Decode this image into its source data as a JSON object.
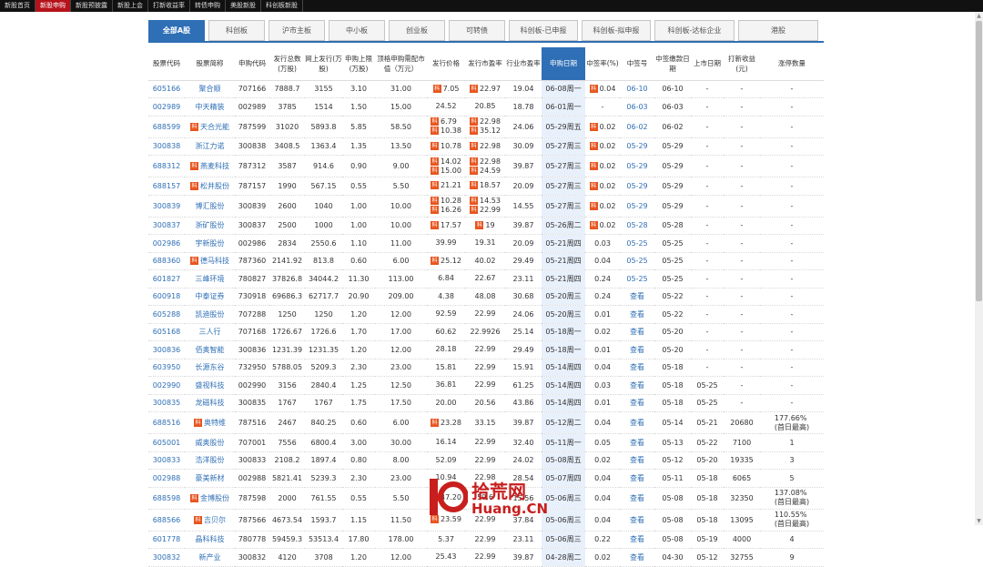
{
  "topnav": [
    {
      "label": "新股首页",
      "active": false
    },
    {
      "label": "新股申购",
      "active": true
    },
    {
      "label": "新股预披露",
      "active": false
    },
    {
      "label": "新股上会",
      "active": false
    },
    {
      "label": "打新收益率",
      "active": false
    },
    {
      "label": "转债申购",
      "active": false
    },
    {
      "label": "美股新股",
      "active": false
    },
    {
      "label": "科创板新股",
      "active": false
    }
  ],
  "tabs": [
    {
      "label": "全部A股",
      "active": true
    },
    {
      "label": "科创板",
      "active": false
    },
    {
      "label": "沪市主板",
      "active": false
    },
    {
      "label": "中小板",
      "active": false
    },
    {
      "label": "创业板",
      "active": false
    },
    {
      "label": "可转债",
      "active": false
    },
    {
      "label": "科创板-已申报",
      "active": false
    },
    {
      "label": "科创板-拟申报",
      "active": false
    },
    {
      "label": "科创板-达标企业",
      "active": false
    },
    {
      "label": "港股",
      "active": false
    }
  ],
  "columns": [
    {
      "label": "股票代码"
    },
    {
      "label": "股票简称"
    },
    {
      "label": "申购代码"
    },
    {
      "label": "发行总数(万股)"
    },
    {
      "label": "网上发行(万股)"
    },
    {
      "label": "申购上限(万股)"
    },
    {
      "label": "顶格申购需配市值（万元）"
    },
    {
      "label": "发行价格"
    },
    {
      "label": "发行市盈率"
    },
    {
      "label": "行业市盈率"
    },
    {
      "label": "申购日期",
      "sorted": true
    },
    {
      "label": "中签率(%)"
    },
    {
      "label": "中签号"
    },
    {
      "label": "中签缴款日期"
    },
    {
      "label": "上市日期"
    },
    {
      "label": "打新收益(元)"
    },
    {
      "label": "涨停数量"
    }
  ],
  "badge_text": "科",
  "rows": [
    {
      "code": "605166",
      "name": "聚合顺",
      "kc": false,
      "subcode": "707166",
      "total": "7888.7",
      "online": "3155",
      "limit": "3.10",
      "cap": "31.00",
      "price": [
        "7.05"
      ],
      "pe": [
        "22.97"
      ],
      "ind_pe": "19.04",
      "date": "06-08周一",
      "rate": "0.04",
      "rate_kc": true,
      "lot": "06-10",
      "pay": "06-10",
      "list": "-",
      "profit": "-",
      "limitup": "-"
    },
    {
      "code": "002989",
      "name": "中天精装",
      "kc": false,
      "subcode": "002989",
      "total": "3785",
      "online": "1514",
      "limit": "1.50",
      "cap": "15.00",
      "price": [
        "24.52"
      ],
      "pe": [
        "20.85"
      ],
      "ind_pe": "18.78",
      "date": "06-01周一",
      "rate": "-",
      "rate_kc": false,
      "lot": "06-03",
      "pay": "06-03",
      "list": "-",
      "profit": "-",
      "limitup": "-"
    },
    {
      "code": "688599",
      "name": "天合光能",
      "kc": true,
      "subcode": "787599",
      "total": "31020",
      "online": "5893.8",
      "limit": "5.85",
      "cap": "58.50",
      "price": [
        "6.79",
        "10.38"
      ],
      "pe": [
        "22.98",
        "35.12"
      ],
      "ind_pe": "24.06",
      "date": "05-29周五",
      "rate": "0.02",
      "rate_kc": true,
      "lot": "06-02",
      "pay": "06-02",
      "list": "-",
      "profit": "-",
      "limitup": "-"
    },
    {
      "code": "300838",
      "name": "浙江力诺",
      "kc": false,
      "subcode": "300838",
      "total": "3408.5",
      "online": "1363.4",
      "limit": "1.35",
      "cap": "13.50",
      "price": [
        "10.78"
      ],
      "pe": [
        "22.98"
      ],
      "ind_pe": "30.09",
      "date": "05-27周三",
      "rate": "0.02",
      "rate_kc": true,
      "lot": "05-29",
      "pay": "05-29",
      "list": "-",
      "profit": "-",
      "limitup": "-"
    },
    {
      "code": "688312",
      "name": "燕麦科技",
      "kc": true,
      "subcode": "787312",
      "total": "3587",
      "online": "914.6",
      "limit": "0.90",
      "cap": "9.00",
      "price": [
        "14.02",
        "15.00"
      ],
      "pe": [
        "22.98",
        "24.59"
      ],
      "ind_pe": "39.87",
      "date": "05-27周三",
      "rate": "0.02",
      "rate_kc": true,
      "lot": "05-29",
      "pay": "05-29",
      "list": "-",
      "profit": "-",
      "limitup": "-"
    },
    {
      "code": "688157",
      "name": "松井股份",
      "kc": true,
      "subcode": "787157",
      "total": "1990",
      "online": "567.15",
      "limit": "0.55",
      "cap": "5.50",
      "price": [
        "21.21"
      ],
      "pe": [
        "18.57"
      ],
      "ind_pe": "20.09",
      "date": "05-27周三",
      "rate": "0.02",
      "rate_kc": true,
      "lot": "05-29",
      "pay": "05-29",
      "list": "-",
      "profit": "-",
      "limitup": "-"
    },
    {
      "code": "300839",
      "name": "博汇股份",
      "kc": false,
      "subcode": "300839",
      "total": "2600",
      "online": "1040",
      "limit": "1.00",
      "cap": "10.00",
      "price": [
        "10.28",
        "16.26"
      ],
      "pe": [
        "14.53",
        "22.99"
      ],
      "ind_pe": "14.55",
      "date": "05-27周三",
      "rate": "0.02",
      "rate_kc": true,
      "lot": "05-29",
      "pay": "05-29",
      "list": "-",
      "profit": "-",
      "limitup": "-"
    },
    {
      "code": "300837",
      "name": "浙矿股份",
      "kc": false,
      "subcode": "300837",
      "total": "2500",
      "online": "1000",
      "limit": "1.00",
      "cap": "10.00",
      "price": [
        "17.57"
      ],
      "pe": [
        "19"
      ],
      "ind_pe": "39.87",
      "date": "05-26周二",
      "rate": "0.02",
      "rate_kc": true,
      "lot": "05-28",
      "pay": "05-28",
      "list": "-",
      "profit": "-",
      "limitup": "-"
    },
    {
      "code": "002986",
      "name": "宇新股份",
      "kc": false,
      "subcode": "002986",
      "total": "2834",
      "online": "2550.6",
      "limit": "1.10",
      "cap": "11.00",
      "price": [
        "39.99"
      ],
      "pe": [
        "19.31"
      ],
      "ind_pe": "20.09",
      "date": "05-21周四",
      "rate": "0.03",
      "rate_kc": false,
      "lot": "05-25",
      "pay": "05-25",
      "list": "-",
      "profit": "-",
      "limitup": "-"
    },
    {
      "code": "688360",
      "name": "德马科技",
      "kc": true,
      "subcode": "787360",
      "total": "2141.92",
      "online": "813.8",
      "limit": "0.60",
      "cap": "6.00",
      "price": [
        "25.12"
      ],
      "pe": [
        "40.02"
      ],
      "ind_pe": "29.49",
      "date": "05-21周四",
      "rate": "0.04",
      "rate_kc": false,
      "lot": "05-25",
      "pay": "05-25",
      "list": "-",
      "profit": "-",
      "limitup": "-"
    },
    {
      "code": "601827",
      "name": "三峰环境",
      "kc": false,
      "subcode": "780827",
      "total": "37826.8",
      "online": "34044.2",
      "limit": "11.30",
      "cap": "113.00",
      "price": [
        "6.84"
      ],
      "pe": [
        "22.67"
      ],
      "ind_pe": "23.11",
      "date": "05-21周四",
      "rate": "0.24",
      "rate_kc": false,
      "lot": "05-25",
      "pay": "05-25",
      "list": "-",
      "profit": "-",
      "limitup": "-"
    },
    {
      "code": "600918",
      "name": "中泰证券",
      "kc": false,
      "subcode": "730918",
      "total": "69686.3",
      "online": "62717.7",
      "limit": "20.90",
      "cap": "209.00",
      "price": [
        "4.38"
      ],
      "pe": [
        "48.08"
      ],
      "ind_pe": "30.68",
      "date": "05-20周三",
      "rate": "0.24",
      "rate_kc": false,
      "lot": "查看",
      "pay": "05-22",
      "list": "-",
      "profit": "-",
      "limitup": "-"
    },
    {
      "code": "605288",
      "name": "凯迪股份",
      "kc": false,
      "subcode": "707288",
      "total": "1250",
      "online": "1250",
      "limit": "1.20",
      "cap": "12.00",
      "price": [
        "92.59"
      ],
      "pe": [
        "22.99"
      ],
      "ind_pe": "24.06",
      "date": "05-20周三",
      "rate": "0.01",
      "rate_kc": false,
      "lot": "查看",
      "pay": "05-22",
      "list": "-",
      "profit": "-",
      "limitup": "-"
    },
    {
      "code": "605168",
      "name": "三人行",
      "kc": false,
      "subcode": "707168",
      "total": "1726.67",
      "online": "1726.6",
      "limit": "1.70",
      "cap": "17.00",
      "price": [
        "60.62"
      ],
      "pe": [
        "22.9926"
      ],
      "ind_pe": "25.14",
      "date": "05-18周一",
      "rate": "0.02",
      "rate_kc": false,
      "lot": "查看",
      "pay": "05-20",
      "list": "-",
      "profit": "-",
      "limitup": "-"
    },
    {
      "code": "300836",
      "name": "佰奥智能",
      "kc": false,
      "subcode": "300836",
      "total": "1231.39",
      "online": "1231.35",
      "limit": "1.20",
      "cap": "12.00",
      "price": [
        "28.18"
      ],
      "pe": [
        "22.99"
      ],
      "ind_pe": "29.49",
      "date": "05-18周一",
      "rate": "0.01",
      "rate_kc": false,
      "lot": "查看",
      "pay": "05-20",
      "list": "-",
      "profit": "-",
      "limitup": "-"
    },
    {
      "code": "603950",
      "name": "长源东谷",
      "kc": false,
      "subcode": "732950",
      "total": "5788.05",
      "online": "5209.3",
      "limit": "2.30",
      "cap": "23.00",
      "price": [
        "15.81"
      ],
      "pe": [
        "22.99"
      ],
      "ind_pe": "15.91",
      "date": "05-14周四",
      "rate": "0.04",
      "rate_kc": false,
      "lot": "查看",
      "pay": "05-18",
      "list": "-",
      "profit": "-",
      "limitup": "-"
    },
    {
      "code": "002990",
      "name": "盛视科技",
      "kc": false,
      "subcode": "002990",
      "total": "3156",
      "online": "2840.4",
      "limit": "1.25",
      "cap": "12.50",
      "price": [
        "36.81"
      ],
      "pe": [
        "22.99"
      ],
      "ind_pe": "61.25",
      "date": "05-14周四",
      "rate": "0.03",
      "rate_kc": false,
      "lot": "查看",
      "pay": "05-18",
      "list": "05-25",
      "profit": "-",
      "limitup": "-"
    },
    {
      "code": "300835",
      "name": "龙磁科技",
      "kc": false,
      "subcode": "300835",
      "total": "1767",
      "online": "1767",
      "limit": "1.75",
      "cap": "17.50",
      "price": [
        "20.00"
      ],
      "pe": [
        "20.56"
      ],
      "ind_pe": "43.86",
      "date": "05-14周四",
      "rate": "0.01",
      "rate_kc": false,
      "lot": "查看",
      "pay": "05-18",
      "list": "05-25",
      "profit": "-",
      "limitup": "-"
    },
    {
      "code": "688516",
      "name": "奥特维",
      "kc": true,
      "subcode": "787516",
      "total": "2467",
      "online": "840.25",
      "limit": "0.60",
      "cap": "6.00",
      "price": [
        "23.28"
      ],
      "pe": [
        "33.15"
      ],
      "ind_pe": "39.87",
      "date": "05-12周二",
      "rate": "0.04",
      "rate_kc": false,
      "lot": "查看",
      "pay": "05-14",
      "list": "05-21",
      "profit": "20680",
      "limitup": [
        "177.66%",
        "(首日最高)"
      ]
    },
    {
      "code": "605001",
      "name": "威奥股份",
      "kc": false,
      "subcode": "707001",
      "total": "7556",
      "online": "6800.4",
      "limit": "3.00",
      "cap": "30.00",
      "price": [
        "16.14"
      ],
      "pe": [
        "22.99"
      ],
      "ind_pe": "32.40",
      "date": "05-11周一",
      "rate": "0.05",
      "rate_kc": false,
      "lot": "查看",
      "pay": "05-13",
      "list": "05-22",
      "profit": "7100",
      "limitup": "1"
    },
    {
      "code": "300833",
      "name": "浩洋股份",
      "kc": false,
      "subcode": "300833",
      "total": "2108.2",
      "online": "1897.4",
      "limit": "0.80",
      "cap": "8.00",
      "price": [
        "52.09"
      ],
      "pe": [
        "22.99"
      ],
      "ind_pe": "24.02",
      "date": "05-08周五",
      "rate": "0.02",
      "rate_kc": false,
      "lot": "查看",
      "pay": "05-12",
      "list": "05-20",
      "profit": "19335",
      "limitup": "3"
    },
    {
      "code": "002988",
      "name": "豪美新材",
      "kc": false,
      "subcode": "002988",
      "total": "5821.41",
      "online": "5239.3",
      "limit": "2.30",
      "cap": "23.00",
      "price": [
        "10.94"
      ],
      "pe": [
        "22.98"
      ],
      "ind_pe": "28.54",
      "date": "05-07周四",
      "rate": "0.04",
      "rate_kc": false,
      "lot": "查看",
      "pay": "05-11",
      "list": "05-18",
      "profit": "6065",
      "limitup": "5"
    },
    {
      "code": "688598",
      "name": "金博股份",
      "kc": true,
      "subcode": "787598",
      "total": "2000",
      "online": "761.55",
      "limit": "0.55",
      "cap": "5.50",
      "price": [
        "47.20"
      ],
      "pe": [
        "59.6"
      ],
      "ind_pe": "15.56",
      "date": "05-06周三",
      "rate": "0.04",
      "rate_kc": false,
      "lot": "查看",
      "pay": "05-08",
      "list": "05-18",
      "profit": "32350",
      "limitup": [
        "137.08%",
        "(首日最高)"
      ]
    },
    {
      "code": "688566",
      "name": "吉贝尔",
      "kc": true,
      "subcode": "787566",
      "total": "4673.54",
      "online": "1593.7",
      "limit": "1.15",
      "cap": "11.50",
      "price": [
        "23.59"
      ],
      "pe": [
        "22.99"
      ],
      "ind_pe": "37.84",
      "date": "05-06周三",
      "rate": "0.04",
      "rate_kc": false,
      "lot": "查看",
      "pay": "05-08",
      "list": "05-18",
      "profit": "13095",
      "limitup": [
        "110.55%",
        "(首日最高)"
      ]
    },
    {
      "code": "601778",
      "name": "晶科科技",
      "kc": false,
      "subcode": "780778",
      "total": "59459.3",
      "online": "53513.4",
      "limit": "17.80",
      "cap": "178.00",
      "price": [
        "5.37"
      ],
      "pe": [
        "22.99"
      ],
      "ind_pe": "23.11",
      "date": "05-06周三",
      "rate": "0.22",
      "rate_kc": false,
      "lot": "查看",
      "pay": "05-08",
      "list": "05-19",
      "profit": "4000",
      "limitup": "4"
    },
    {
      "code": "300832",
      "name": "新产业",
      "kc": false,
      "subcode": "300832",
      "total": "4120",
      "online": "3708",
      "limit": "1.20",
      "cap": "12.00",
      "price": [
        "25.43"
      ],
      "pe": [
        "22.99"
      ],
      "ind_pe": "39.87",
      "date": "04-28周二",
      "rate": "0.02",
      "rate_kc": false,
      "lot": "查看",
      "pay": "04-30",
      "list": "05-12",
      "profit": "32755",
      "limitup": "9"
    }
  ],
  "watermark": {
    "cn": "拾荒网",
    "en": "Huang.CN"
  }
}
